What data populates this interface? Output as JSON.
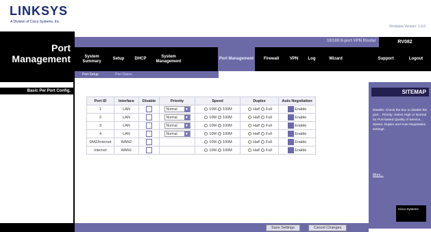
{
  "brand": {
    "logo": "LINKSYS",
    "tagline": "A Division of Cisco Systems, Inc.",
    "firmware": "Firmware Version: 1.0.0"
  },
  "header": {
    "page_title": "Port Management",
    "model_name": "10/100 8-port VPN Router",
    "model": "RV082"
  },
  "nav": {
    "tabs": [
      {
        "label": "System Summary"
      },
      {
        "label": "Setup"
      },
      {
        "label": "DHCP"
      },
      {
        "label": "System Management"
      },
      {
        "label": "Port Management"
      },
      {
        "label": "Firewall"
      },
      {
        "label": "VPN"
      },
      {
        "label": "Log"
      },
      {
        "label": "Wizard"
      },
      {
        "label": "Support"
      },
      {
        "label": "Logout"
      }
    ],
    "subtabs": [
      {
        "label": "Port Setup"
      },
      {
        "label": "Port Status"
      }
    ]
  },
  "sidebar": {
    "section": "Basic Per Port Config."
  },
  "table": {
    "headers": [
      "Port ID",
      "Interface",
      "Disable",
      "Priority",
      "Speed",
      "Duplex",
      "Auto Negotiation"
    ],
    "rows": [
      {
        "port_id": "1",
        "interface": "LAN",
        "priority": "Normal",
        "speed_a": "10M",
        "speed_b": "100M",
        "duplex_a": "Half",
        "duplex_b": "Full",
        "auto": "Enable"
      },
      {
        "port_id": "2",
        "interface": "LAN",
        "priority": "Normal",
        "speed_a": "10M",
        "speed_b": "100M",
        "duplex_a": "Half",
        "duplex_b": "Full",
        "auto": "Enable"
      },
      {
        "port_id": "3",
        "interface": "LAN",
        "priority": "Normal",
        "speed_a": "10M",
        "speed_b": "100M",
        "duplex_a": "Half",
        "duplex_b": "Full",
        "auto": "Enable"
      },
      {
        "port_id": "4",
        "interface": "LAN",
        "priority": "Normal",
        "speed_a": "10M",
        "speed_b": "100M",
        "duplex_a": "Half",
        "duplex_b": "Full",
        "auto": "Enable"
      },
      {
        "port_id": "DMZ/Internet",
        "interface": "WAN2",
        "priority": "",
        "speed_a": "10M",
        "speed_b": "100M",
        "duplex_a": "Half",
        "duplex_b": "Full",
        "auto": "Enable"
      },
      {
        "port_id": "Internet",
        "interface": "WAN1",
        "priority": "",
        "speed_a": "10M",
        "speed_b": "100M",
        "duplex_a": "Half",
        "duplex_b": "Full",
        "auto": "Enable"
      }
    ]
  },
  "sitemap": {
    "title": "SITEMAP",
    "text": "Disable: Check the box to disable the port... Priority: Select High or Normal for Port-based Quality of Service... Speed, Duplex and Auto Negotiation settings.",
    "more": "More..."
  },
  "cisco": "Cisco Systems",
  "buttons": {
    "save": "Save Settings",
    "cancel": "Cancel Changes"
  }
}
